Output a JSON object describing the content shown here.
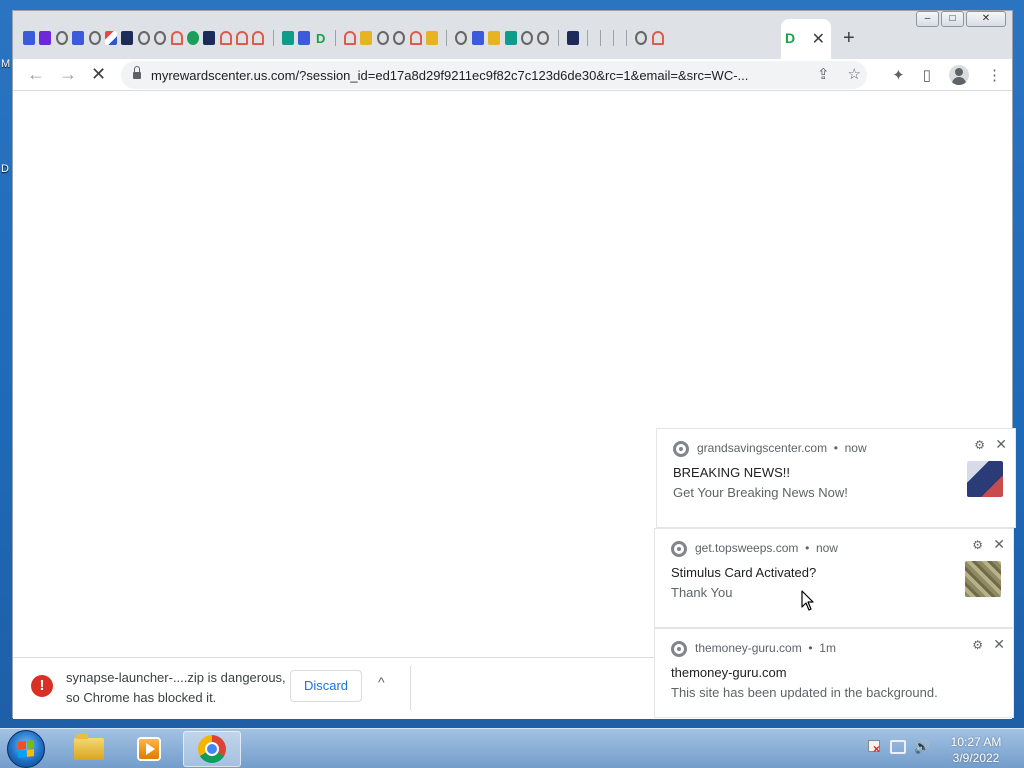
{
  "desktop": {
    "left_letters": [
      "M",
      "D"
    ]
  },
  "browser": {
    "window_controls": {
      "minimize": "▭",
      "maximize": "◻",
      "close": "✕"
    },
    "tabs": {
      "active_tab_close": "✕",
      "new_tab": "+"
    },
    "toolbar": {
      "url": "myrewardscenter.us.com/?session_id=ed17a8d29f9211ec9f82c7c123d6de30&rc=1&email=&src=WC-...",
      "back": "←",
      "forward": "→",
      "reload": "✕",
      "share": "⇪",
      "bookmark": "☆",
      "extensions": "✦",
      "sidepanel": "▯",
      "menu": "⋮"
    },
    "download_bar": {
      "warning_icon": "!",
      "message_line1": "synapse-launcher-....zip is dangerous,",
      "message_line2": "so Chrome has blocked it.",
      "discard_label": "Discard",
      "chevron": "^"
    }
  },
  "notifications": [
    {
      "site": "grandsavingscenter.com",
      "time": "now",
      "title": "BREAKING NEWS!!",
      "body": "Get Your Breaking News Now!",
      "image": "news-thumbnail"
    },
    {
      "site": "get.topsweeps.com",
      "time": "now",
      "title": "Stimulus Card Activated?",
      "body": "Thank You",
      "image": "money-thumbnail"
    },
    {
      "site": "themoney-guru.com",
      "time": "1m",
      "title": "themoney-guru.com",
      "body": "This site has been updated in the background.",
      "image": null
    }
  ],
  "notification_ui": {
    "gear": "⚙",
    "close": "✕",
    "separator": "•"
  },
  "taskbar": {
    "clock_time": "10:27 AM",
    "clock_date": "3/9/2022",
    "volume": "🔊"
  }
}
